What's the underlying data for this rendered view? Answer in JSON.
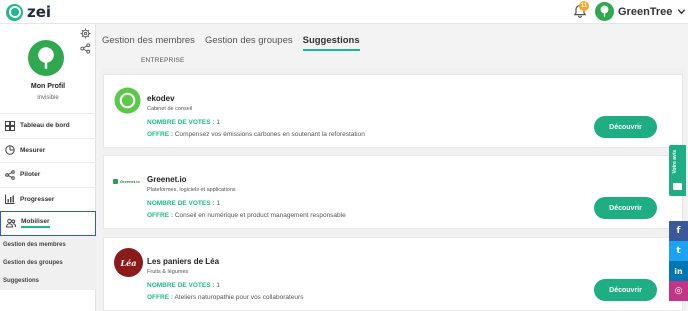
{
  "app": {
    "logo_text": "zei"
  },
  "header": {
    "notification_count": "11",
    "user_name": "GreenTree"
  },
  "profile": {
    "name": "Mon Profil",
    "status": "invisible"
  },
  "sidebar": {
    "items": [
      {
        "label": "Tableau de bord",
        "icon": "grid-icon"
      },
      {
        "label": "Mesurer",
        "icon": "gauge-icon"
      },
      {
        "label": "Piloter",
        "icon": "share-nodes-icon"
      },
      {
        "label": "Progresser",
        "icon": "bar-chart-icon"
      },
      {
        "label": "Mobiliser",
        "icon": "people-icon",
        "active": true
      }
    ],
    "subitems": [
      {
        "label": "Gestion des membres"
      },
      {
        "label": "Gestion des groupes"
      },
      {
        "label": "Suggestions"
      }
    ]
  },
  "tabs": [
    {
      "label": "Gestion des membres"
    },
    {
      "label": "Gestion des groupes"
    },
    {
      "label": "Suggestions",
      "active": true
    }
  ],
  "section_label": "ENTREPRISE",
  "labels": {
    "votes": "NOMBRE DE VOTES :",
    "offer": "OFFRE :",
    "button": "Découvrir"
  },
  "cards": [
    {
      "title": "ekodev",
      "category": "Cabinet de conseil",
      "votes": "1",
      "offer": "Compensez vos émissions carbones en soutenant la reforestation"
    },
    {
      "title": "Greenet.io",
      "category": "Plateformes, logiciels et applications",
      "votes": "1",
      "offer": "Conseil en numérique et product management responsable",
      "logo_text": "Greenet.io"
    },
    {
      "title": "Les paniers de Léa",
      "category": "Fruits & légumes",
      "votes": "1",
      "offer": "Ateliers naturopathie pour vos collaborateurs",
      "logo_text": "Léa"
    }
  ],
  "feedback": {
    "label": "Votre avis"
  },
  "social": [
    {
      "icon": "facebook-icon",
      "glyph": "f",
      "color": "#3b5998"
    },
    {
      "icon": "twitter-icon",
      "glyph": "t",
      "color": "#1da1f2"
    },
    {
      "icon": "linkedin-icon",
      "glyph": "in",
      "color": "#0077b5"
    },
    {
      "icon": "instagram-icon",
      "glyph": "◎",
      "color": "#c13584"
    }
  ],
  "colors": {
    "accent": "#1fae84",
    "brand": "#1fb88a",
    "active_border": "#2f5bd8"
  }
}
